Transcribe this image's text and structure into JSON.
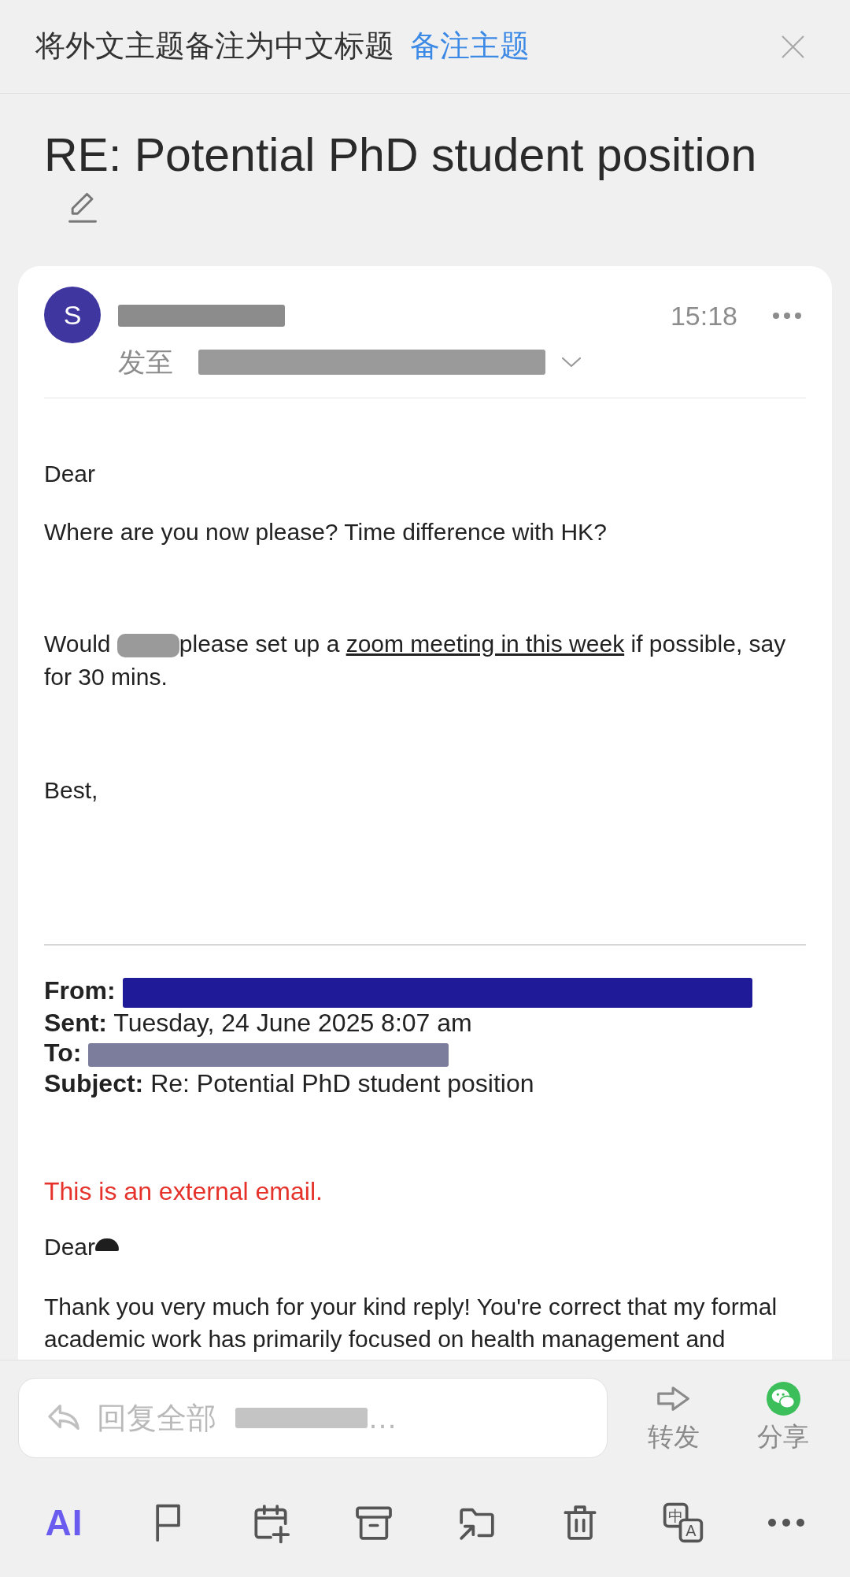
{
  "banner": {
    "text": "将外文主题备注为中文标题",
    "action": "备注主题"
  },
  "subject": "RE: Potential PhD student position",
  "message": {
    "avatar": "S",
    "sender": [
      {
        "kind": "redaction",
        "color": "#8c8c8c"
      }
    ],
    "to_label": "发至",
    "recipients": [
      {
        "kind": "redaction",
        "color": "#9a9a9a"
      }
    ],
    "time": "15:18",
    "paragraphs": [
      {
        "runs": [
          {
            "kind": "text",
            "text": "Dear"
          }
        ]
      },
      {
        "runs": [
          {
            "kind": "text",
            "text": "Where are you now please? Time difference with HK?"
          }
        ]
      },
      {
        "runs": [
          {
            "kind": "text",
            "text": "Would "
          },
          {
            "kind": "redaction",
            "color": "#9a9a9a"
          },
          {
            "kind": "text",
            "text": "please set up a "
          },
          {
            "kind": "link",
            "text": "zoom meeting in this week"
          },
          {
            "kind": "text",
            "text": " if possible, say for 30 mins."
          }
        ]
      },
      {
        "runs": [
          {
            "kind": "text",
            "text": "Best,"
          }
        ]
      }
    ],
    "quoted": {
      "header": [
        {
          "label": "From:",
          "runs": [
            {
              "kind": "redaction",
              "color": "#1f1b98"
            }
          ]
        },
        {
          "label": "Sent:",
          "runs": [
            {
              "kind": "text",
              "text": "Tuesday, 24 June 2025 8:07 am"
            }
          ]
        },
        {
          "label": "To:",
          "runs": [
            {
              "kind": "redaction",
              "color": "#7c7c9c"
            }
          ]
        },
        {
          "label": "Subject:",
          "runs": [
            {
              "kind": "text",
              "text": "Re: Potential PhD student position"
            }
          ]
        }
      ],
      "notice": "This is an external email.",
      "paragraphs": [
        {
          "runs": [
            {
              "kind": "text",
              "text": "Dear"
            },
            {
              "kind": "redaction",
              "color": "#1e1e1e"
            }
          ]
        },
        {
          "runs": [
            {
              "kind": "text",
              "text": "Thank you very much for your kind reply! You're correct that my formal academic work has primarily focused on health management and"
            }
          ]
        }
      ]
    }
  },
  "reply": {
    "placeholder": "回复全部",
    "redaction": {
      "color": "#c4c4c4"
    },
    "ellipsis": "…"
  },
  "actions": [
    {
      "kind": "forward",
      "label": "转发"
    },
    {
      "kind": "share",
      "label": "分享"
    }
  ],
  "toolbar": [
    {
      "kind": "ai",
      "label": "AI"
    },
    {
      "kind": "flag"
    },
    {
      "kind": "calendar_add"
    },
    {
      "kind": "archive"
    },
    {
      "kind": "move"
    },
    {
      "kind": "delete"
    },
    {
      "kind": "translate",
      "glyphs": [
        "中",
        "A"
      ]
    },
    {
      "kind": "more"
    }
  ]
}
